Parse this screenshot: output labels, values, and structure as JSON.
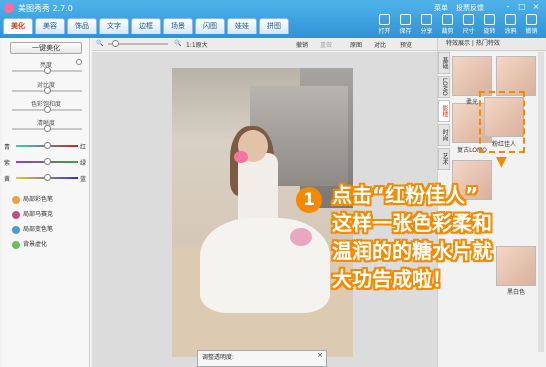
{
  "app": {
    "title": "美图秀秀 2.7.0"
  },
  "top_links": [
    "菜单",
    "投票反馈"
  ],
  "window_controls": [
    "-",
    "□",
    "×"
  ],
  "tabs": [
    "美化",
    "美容",
    "饰品",
    "文字",
    "边框",
    "场景",
    "闪图",
    "娃娃",
    "拼图"
  ],
  "tools": [
    "打开",
    "保存",
    "分享",
    "裁剪",
    "尺寸",
    "旋转",
    "涂鸦",
    "撤销"
  ],
  "left": {
    "onekey_label": "一键美化",
    "sliders": [
      {
        "label": "亮度",
        "value": 0.5
      },
      {
        "label": "对比度",
        "value": 0.5
      },
      {
        "label": "色彩饱和度",
        "value": 0.5
      },
      {
        "label": "清晰度",
        "value": 0.5
      }
    ],
    "color_rows": [
      {
        "left": "青",
        "right": "红",
        "value": 0.5,
        "color": "#c23"
      },
      {
        "left": "紫",
        "right": "绿",
        "value": 0.5,
        "color": "#3a3"
      },
      {
        "left": "黄",
        "right": "蓝",
        "value": 0.5,
        "color": "#33c"
      }
    ],
    "pens": [
      "局部彩色笔",
      "局部马赛克",
      "局部变色笔",
      "背景虚化"
    ]
  },
  "canvas_toolbar": {
    "zoom": "1:1原大",
    "undo": "撤销",
    "redo": "重做",
    "original": "原图",
    "compare": "对比",
    "detail": "预览"
  },
  "opacity_popup": {
    "label": "调整透明度:",
    "close": "×"
  },
  "right": {
    "header": "特效展示 | 热门特效",
    "categories": [
      "基础",
      "LOMO",
      "影楼",
      "时尚",
      "艺术"
    ],
    "thumbs": [
      {
        "label": ""
      },
      {
        "label": ""
      },
      {
        "label": "柔光"
      },
      {
        "label": ""
      },
      {
        "label": "复古LOMO"
      },
      {
        "label": "粉红佳人"
      },
      {
        "label": ""
      },
      {
        "label": "黑白色"
      }
    ]
  },
  "annotation": {
    "number": "1",
    "lines": [
      "点击“红粉佳人”",
      "这样一张色彩柔和",
      "温润的的糖水片就",
      "大功告成啦！"
    ]
  }
}
